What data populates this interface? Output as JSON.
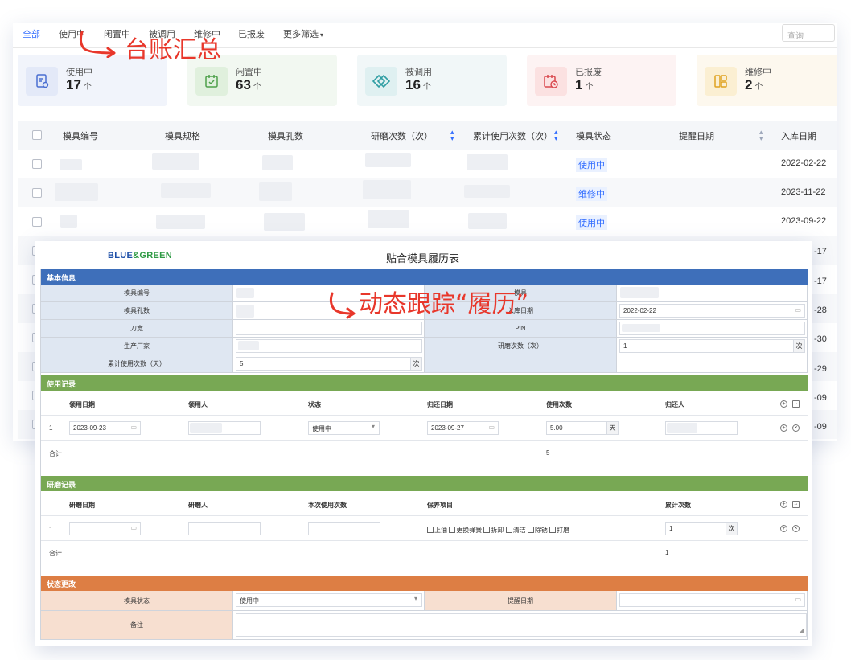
{
  "tabs": [
    {
      "label": "全部",
      "active": true
    },
    {
      "label": "使用中"
    },
    {
      "label": "闲置中"
    },
    {
      "label": "被调用"
    },
    {
      "label": "维修中"
    },
    {
      "label": "已报废"
    },
    {
      "label": "更多筛选"
    }
  ],
  "search": {
    "placeholder": "查询"
  },
  "stats": [
    {
      "label": "使用中",
      "value": "17",
      "unit": "个",
      "icon": "document-check-icon",
      "bg": "#f1f4fb",
      "icon_bg": "#e3e9f8",
      "icon_color": "#4a6fd1"
    },
    {
      "label": "闲置中",
      "value": "63",
      "unit": "个",
      "icon": "calendar-check-icon",
      "bg": "#f2f8f1",
      "icon_bg": "#e0f0dd",
      "icon_color": "#4da04a"
    },
    {
      "label": "被调用",
      "value": "16",
      "unit": "个",
      "icon": "diamond-transfer-icon",
      "bg": "#f1f7f8",
      "icon_bg": "#dff0f1",
      "icon_color": "#2f9ea3"
    },
    {
      "label": "已报废",
      "value": "1",
      "unit": "个",
      "icon": "calendar-clock-icon",
      "bg": "#fdf3f3",
      "icon_bg": "#fbe1e1",
      "icon_color": "#d9484e"
    },
    {
      "label": "维修中",
      "value": "2",
      "unit": "个",
      "icon": "layout-icon",
      "bg": "#fdf8ee",
      "icon_bg": "#fbefd2",
      "icon_color": "#e0a21e"
    }
  ],
  "table": {
    "columns": [
      "模具编号",
      "模具规格",
      "模具孔数",
      "研磨次数（次）",
      "累计使用次数（次）",
      "模具状态",
      "提醒日期",
      "入库日期"
    ],
    "rows": [
      {
        "status": "使用中",
        "date": "2022-02-22"
      },
      {
        "status": "维修中",
        "date": "2023-11-22"
      },
      {
        "status": "使用中",
        "date": "2023-09-22"
      }
    ],
    "side_dates": [
      "-17",
      "-17",
      "-28",
      "-30",
      "-29",
      "-09",
      "-09"
    ]
  },
  "annotations": {
    "summary": "台账汇总",
    "tracking": "动态跟踪“履历”"
  },
  "form": {
    "logo": {
      "blue": "BLUE",
      "amp": "&",
      "green": "GREEN"
    },
    "title": "贴合模具履历表",
    "basic": {
      "header": "基本信息",
      "mold_no_label": "模具编号",
      "holes_label": "模具孔数",
      "blade_width_label": "刀宽",
      "manufacturer_label": "生产厂家",
      "cum_use_label": "累计使用次数（天）",
      "cum_use_value": "5",
      "cum_use_unit": "次",
      "mold_spec_label": "模具",
      "storage_date_label": "入库日期",
      "storage_date_value": "2022-02-22",
      "pin_label": "PIN",
      "grind_count_label": "研磨次数（次）",
      "grind_count_value": "1",
      "grind_count_unit": "次"
    },
    "usage": {
      "header": "使用记录",
      "columns": [
        "领用日期",
        "领用人",
        "状态",
        "归还日期",
        "使用次数",
        "归还人"
      ],
      "row_index": "1",
      "borrow_date": "2023-09-23",
      "status": "使用中",
      "return_date": "2023-09-27",
      "use_count": "5.00",
      "use_unit": "天",
      "total_label": "合计",
      "total_value": "5"
    },
    "grinding": {
      "header": "研磨记录",
      "columns": [
        "研磨日期",
        "研磨人",
        "本次使用次数",
        "保养项目",
        "累计次数"
      ],
      "row_index": "1",
      "maintenance_items": [
        "上油",
        "更换弹簧",
        "拆卸",
        "清洁",
        "除锈",
        "打磨"
      ],
      "cum_value": "1",
      "cum_unit": "次",
      "total_label": "合计",
      "total_value": "1"
    },
    "status_change": {
      "header": "状态更改",
      "status_label": "模具状态",
      "status_value": "使用中",
      "reminder_label": "提醒日期",
      "remark_label": "备注"
    }
  }
}
